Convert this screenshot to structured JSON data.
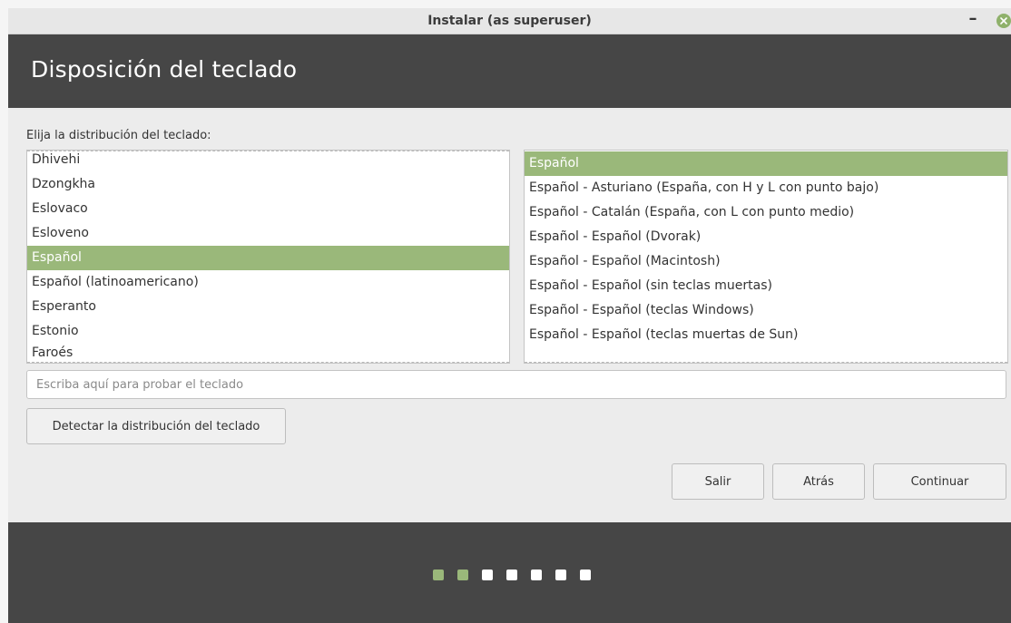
{
  "window": {
    "title": "Instalar (as superuser)",
    "minimize_glyph": "–",
    "close_icon": "close-icon",
    "accent_color": "#9ab87a"
  },
  "header": {
    "title": "Disposición del teclado",
    "background": "#464646"
  },
  "instruction": "Elija la distribución del teclado:",
  "layouts": {
    "items": [
      {
        "label": "Dhivehi",
        "selected": false
      },
      {
        "label": "Dzongkha",
        "selected": false
      },
      {
        "label": "Eslovaco",
        "selected": false
      },
      {
        "label": "Esloveno",
        "selected": false
      },
      {
        "label": "Español",
        "selected": true
      },
      {
        "label": "Español (latinoamericano)",
        "selected": false
      },
      {
        "label": "Esperanto",
        "selected": false
      },
      {
        "label": "Estonio",
        "selected": false
      },
      {
        "label": "Faroés",
        "selected": false
      }
    ]
  },
  "variants": {
    "items": [
      {
        "label": "Español",
        "selected": true
      },
      {
        "label": "Español - Asturiano (España, con H y L con punto bajo)",
        "selected": false
      },
      {
        "label": "Español - Catalán (España, con L con punto medio)",
        "selected": false
      },
      {
        "label": "Español - Español (Dvorak)",
        "selected": false
      },
      {
        "label": "Español - Español (Macintosh)",
        "selected": false
      },
      {
        "label": "Español - Español (sin teclas muertas)",
        "selected": false
      },
      {
        "label": "Español - Español (teclas Windows)",
        "selected": false
      },
      {
        "label": "Español - Español (teclas muertas de Sun)",
        "selected": false
      }
    ]
  },
  "test_input": {
    "placeholder": "Escriba aquí para probar el teclado",
    "value": ""
  },
  "buttons": {
    "detect": "Detectar la distribución del teclado",
    "quit": "Salir",
    "back": "Atrás",
    "continue": "Continuar"
  },
  "progress": {
    "total_steps": 7,
    "completed_steps": 2
  }
}
